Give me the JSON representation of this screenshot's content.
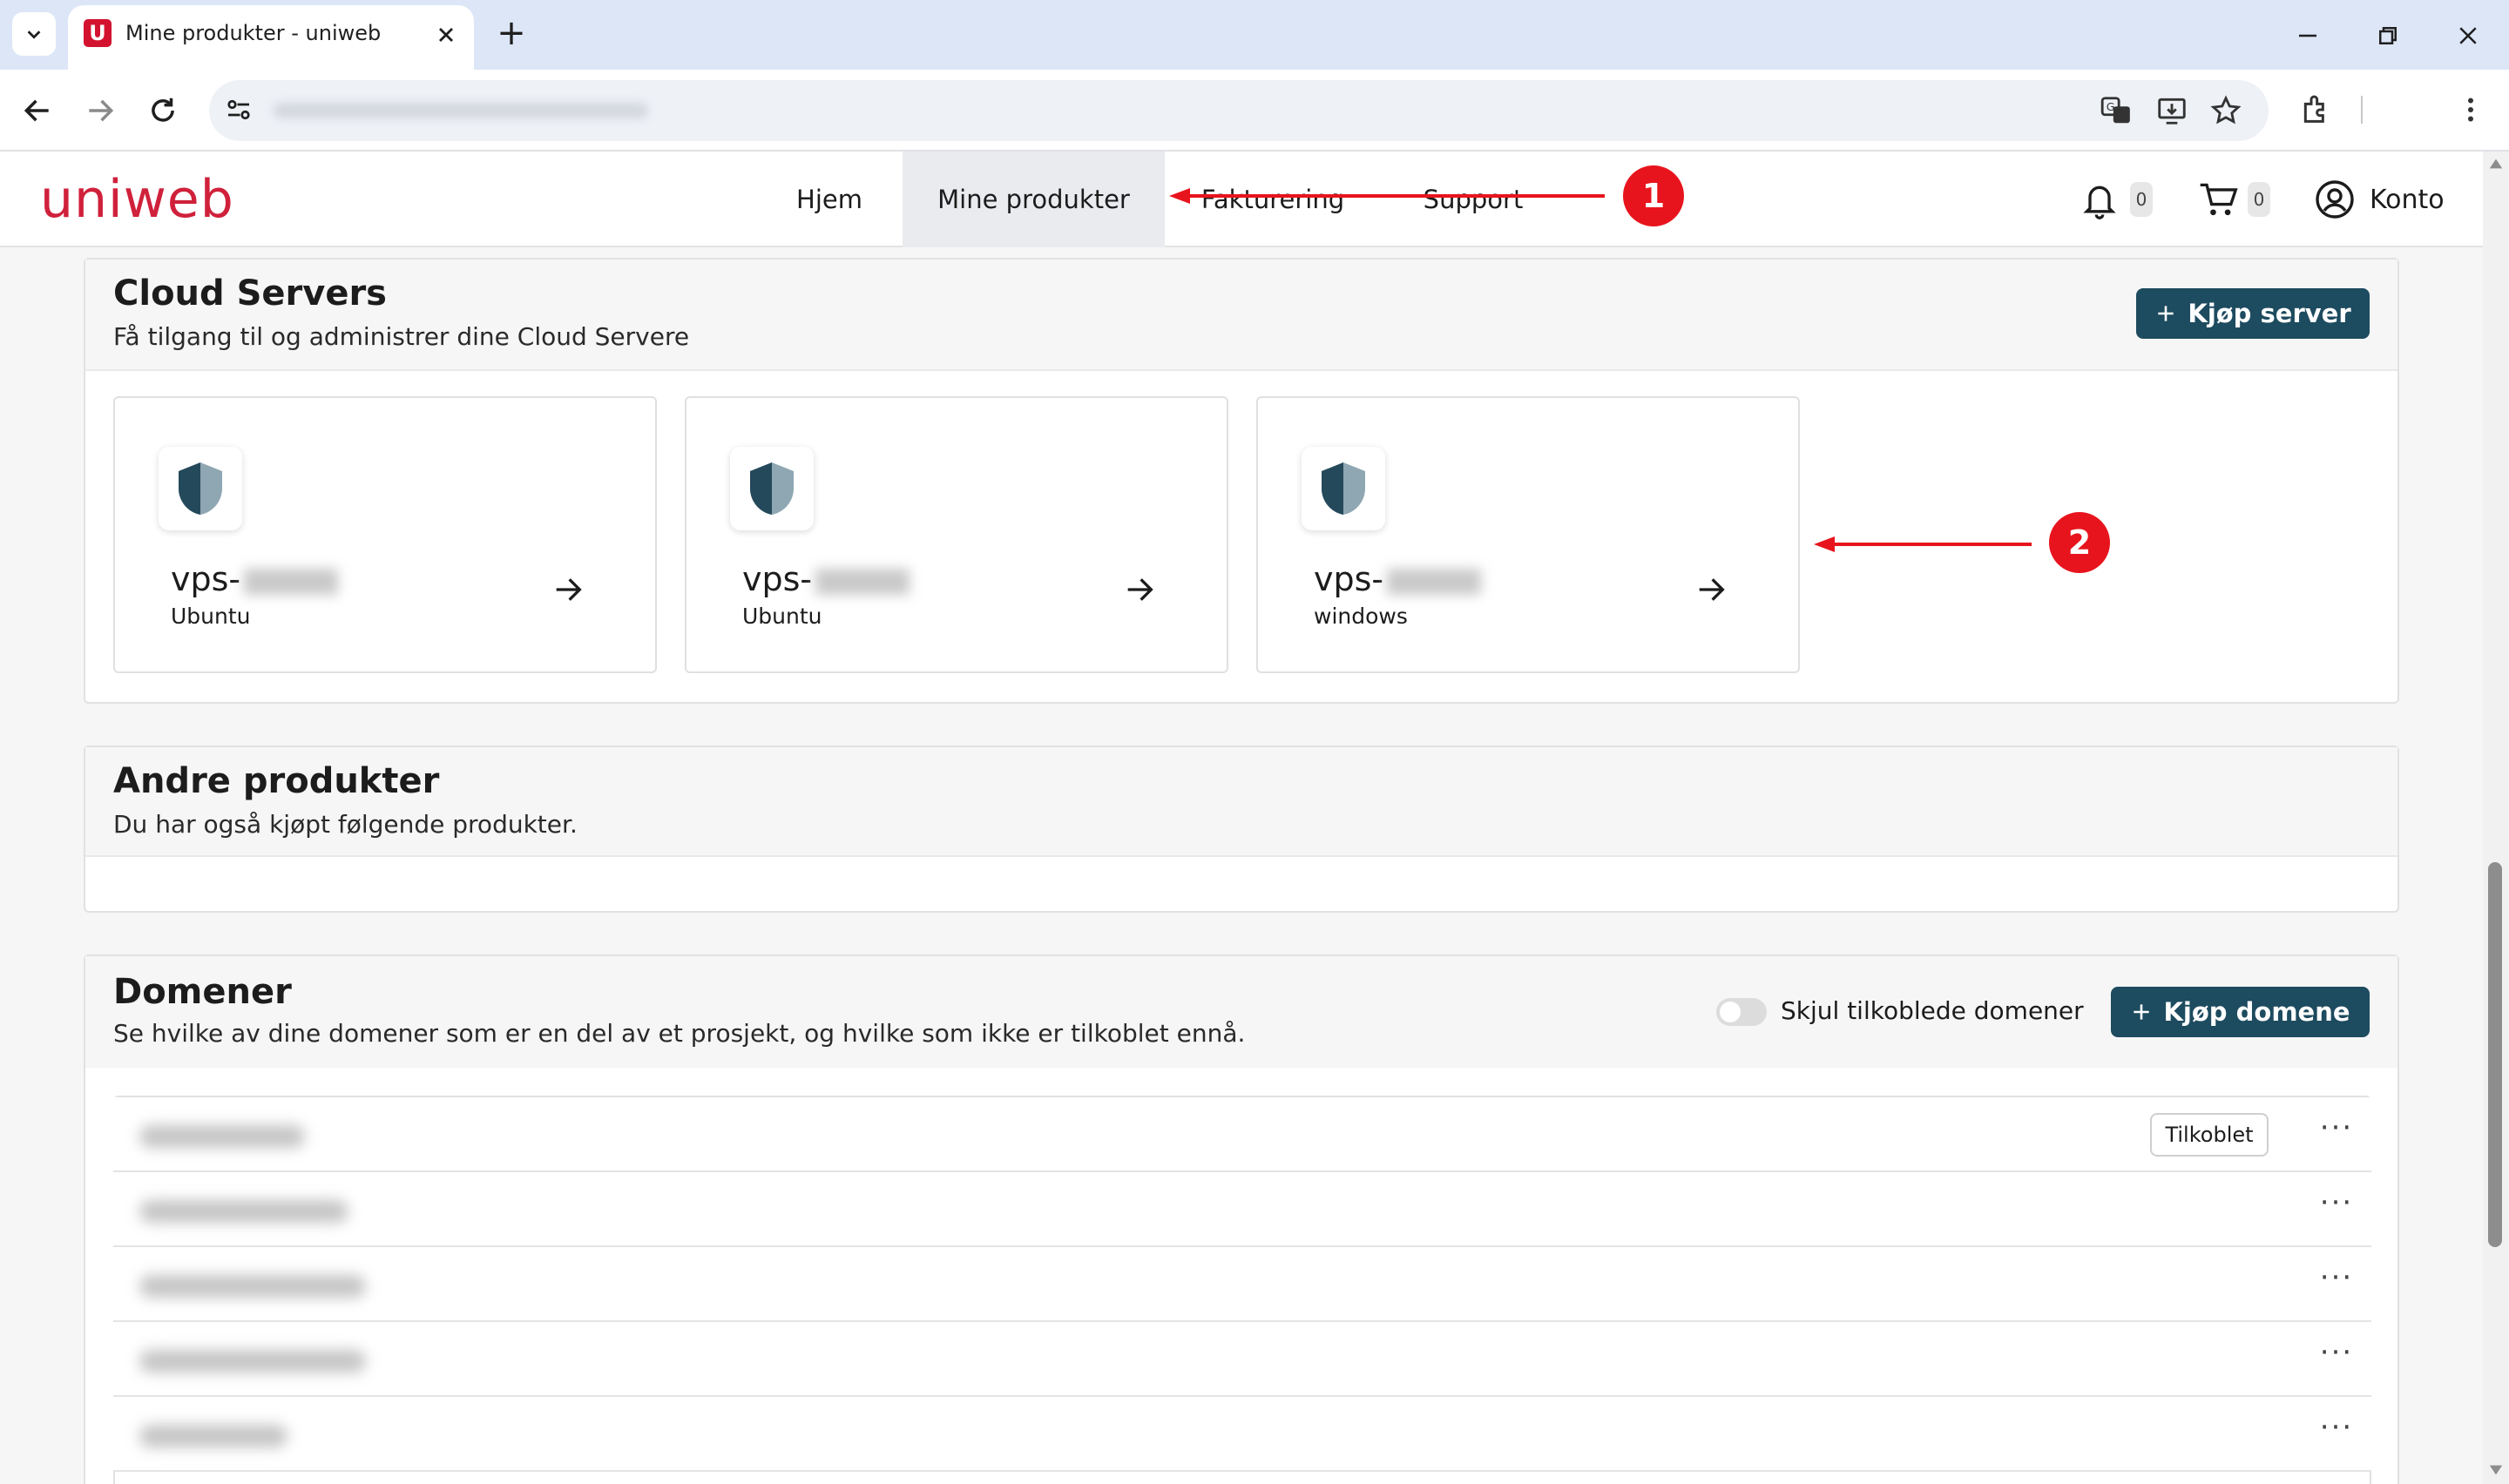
{
  "browser": {
    "tab_title": "Mine produkter - uniweb",
    "tab_icon": "U",
    "new_tab_symbol": "+"
  },
  "site": {
    "logo": "uniweb",
    "nav": [
      "Hjem",
      "Mine produkter",
      "Fakturering",
      "Support"
    ],
    "active_nav": "Mine produkter",
    "notifications_count": "0",
    "cart_count": "0",
    "account_label": "Konto",
    "accent_color": "#d0213b",
    "button_color": "#1d4b5f"
  },
  "annotations": [
    "1",
    "2"
  ],
  "cloud": {
    "title": "Cloud Servers",
    "subtitle": "Få tilgang til og administrer dine Cloud Servere",
    "buy_button": "Kjøp server",
    "servers": [
      {
        "name_prefix": "vps-",
        "os": "Ubuntu"
      },
      {
        "name_prefix": "vps-",
        "os": "Ubuntu"
      },
      {
        "name_prefix": "vps-",
        "os": "windows"
      }
    ]
  },
  "other": {
    "title": "Andre produkter",
    "subtitle": "Du har også kjøpt følgende produkter."
  },
  "domains": {
    "title": "Domener",
    "subtitle": "Se hvilke av dine domener som er en del av et prosjekt, og hvilke som ikke er tilkoblet ennå.",
    "toggle_label": "Skjul tilkoblede domener",
    "buy_button": "Kjøp domene",
    "connected_tag": "Tilkoblet",
    "more_symbol": "···"
  }
}
